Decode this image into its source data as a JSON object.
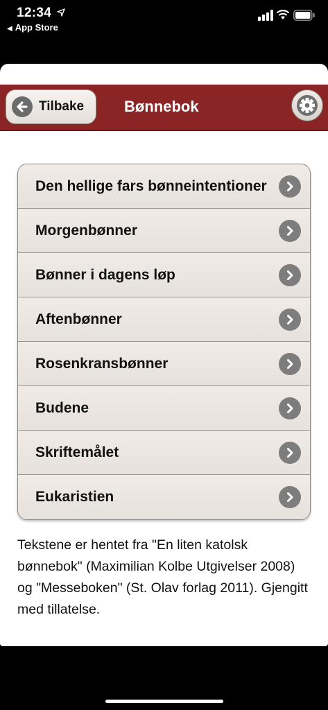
{
  "status_bar": {
    "time": "12:34",
    "back_app": "App Store",
    "icons": [
      "location-arrow-icon",
      "signal-bars-icon",
      "wifi-icon",
      "battery-icon"
    ]
  },
  "navbar": {
    "back_label": "Tilbake",
    "title": "Bønnebok",
    "color": "#8b2525"
  },
  "list": {
    "items": [
      {
        "label": "Den hellige fars bønneintentioner"
      },
      {
        "label": "Morgenbønner"
      },
      {
        "label": "Bønner i dagens løp"
      },
      {
        "label": "Aftenbønner"
      },
      {
        "label": "Rosenkransbønner"
      },
      {
        "label": "Budene"
      },
      {
        "label": "Skriftemålet"
      },
      {
        "label": "Eukaristien"
      }
    ]
  },
  "footer": {
    "text": "Tekstene er hentet fra \"En liten katolsk bønnebok\" (Maximilian Kolbe Utgivelser 2008) og \"Messeboken\" (St. Olav forlag 2011). Gjengitt med tillatelse."
  }
}
